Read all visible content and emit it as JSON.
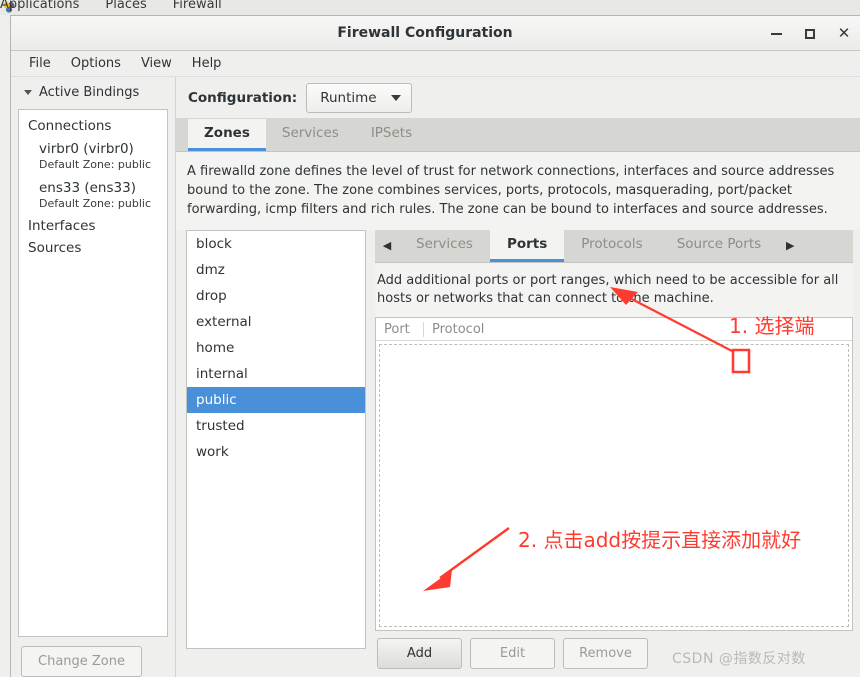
{
  "desktop_panel": {
    "logo_icon": "gnome-applications-icon",
    "items": [
      "Applications",
      "Places",
      "Firewall"
    ]
  },
  "window": {
    "title": "Firewall Configuration",
    "controls": {
      "minimize": "minimize-icon",
      "maximize": "maximize-icon",
      "close": "close-icon"
    }
  },
  "menubar": {
    "items": [
      "File",
      "Options",
      "View",
      "Help"
    ]
  },
  "sidebar": {
    "header_label": "Active Bindings",
    "chevron_icon": "chevron-down-icon",
    "groups": [
      {
        "label": "Connections"
      },
      {
        "label": "Interfaces"
      },
      {
        "label": "Sources"
      }
    ],
    "connections": [
      {
        "name": "virbr0 (virbr0)",
        "sub": "Default Zone: public"
      },
      {
        "name": "ens33 (ens33)",
        "sub": "Default Zone: public"
      }
    ],
    "change_zone_label": "Change Zone"
  },
  "toolbar": {
    "config_label": "Configuration:",
    "config_value": "Runtime",
    "caret_icon": "caret-down-icon"
  },
  "main_tabs": [
    {
      "label": "Zones",
      "active": true
    },
    {
      "label": "Services",
      "active": false
    },
    {
      "label": "IPSets",
      "active": false
    }
  ],
  "zone_description": "A firewalld zone defines the level of trust for network connections, interfaces and source addresses bound to the zone. The zone combines services, ports, protocols, masquerading, port/packet forwarding, icmp filters and rich rules. The zone can be bound to interfaces and source addresses.",
  "zones": [
    {
      "name": "block",
      "selected": false
    },
    {
      "name": "dmz",
      "selected": false
    },
    {
      "name": "drop",
      "selected": false
    },
    {
      "name": "external",
      "selected": false
    },
    {
      "name": "home",
      "selected": false
    },
    {
      "name": "internal",
      "selected": false
    },
    {
      "name": "public",
      "selected": true
    },
    {
      "name": "trusted",
      "selected": false
    },
    {
      "name": "work",
      "selected": false
    }
  ],
  "sub_tabs": {
    "scroll_left_icon": "triangle-left-icon",
    "scroll_right_icon": "triangle-right-icon",
    "items": [
      {
        "label": "Services",
        "active": false
      },
      {
        "label": "Ports",
        "active": true
      },
      {
        "label": "Protocols",
        "active": false
      },
      {
        "label": "Source Ports",
        "active": false
      }
    ]
  },
  "ports_panel": {
    "description": "Add additional ports or port ranges, which need to be accessible for all hosts or networks that can connect to the machine.",
    "table": {
      "columns": [
        "Port",
        "Protocol"
      ],
      "rows": []
    },
    "buttons": [
      {
        "label": "Add",
        "enabled": true
      },
      {
        "label": "Edit",
        "enabled": false
      },
      {
        "label": "Remove",
        "enabled": false
      }
    ]
  },
  "annotations": [
    {
      "id": "step-1",
      "text": "1. 选择端"
    },
    {
      "id": "step-2",
      "text": "2. 点击add按提示直接添加就好"
    }
  ],
  "watermark": "CSDN @指数反对数",
  "colors": {
    "accent": "#4a90d9",
    "selection": "#4a90d9",
    "annotation": "#ff3b30",
    "window_bg": "#efefee",
    "tabstrip_bg": "#d6d6d2"
  }
}
